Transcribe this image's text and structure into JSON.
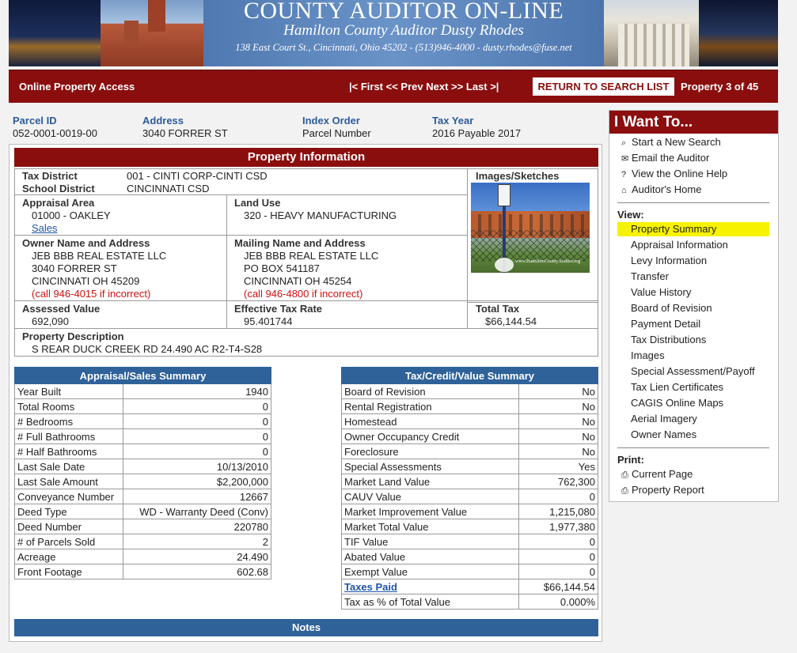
{
  "banner": {
    "title": "COUNTY AUDITOR ON-LINE",
    "subtitle": "Hamilton County Auditor Dusty Rhodes",
    "address": "138 East Court St., Cincinnati, Ohio 45202 - (513)946-4000 - dusty.rhodes@fuse.net"
  },
  "navbar": {
    "title": "Online Property Access",
    "first": "|< First",
    "prev": "<< Prev",
    "next": "Next >>",
    "last": "Last >|",
    "return": "RETURN TO SEARCH LIST",
    "position": "Property 3 of 45"
  },
  "header": {
    "parcel_label": "Parcel ID",
    "parcel_value": "052-0001-0019-00",
    "address_label": "Address",
    "address_value": "3040 FORRER ST",
    "index_label": "Index Order",
    "index_value": "Parcel Number",
    "taxyear_label": "Tax Year",
    "taxyear_value": "2016 Payable 2017"
  },
  "property_info": {
    "heading": "Property Information",
    "tax_district_label": "Tax District",
    "tax_district_value": "001 - CINTI CORP-CINTI CSD",
    "school_district_label": "School District",
    "school_district_value": "CINCINNATI CSD",
    "images_label": "Images/Sketches",
    "appraisal_area_label": "Appraisal Area",
    "appraisal_area_value": "01000 - OAKLEY",
    "sales_link": "Sales",
    "land_use_label": "Land Use",
    "land_use_value": "320 - HEAVY MANUFACTURING",
    "owner_label": "Owner Name and Address",
    "owner_line1": "JEB BBB REAL ESTATE LLC",
    "owner_line2": "3040 FORRER ST",
    "owner_line3": "CINCINNATI OH 45209",
    "owner_call": "(call 946-4015 if incorrect)",
    "mailing_label": "Mailing Name and Address",
    "mailing_line1": "JEB BBB REAL ESTATE LLC",
    "mailing_line2": "PO BOX 541187",
    "mailing_line3": "CINCINNATI OH 45254",
    "mailing_call": "(call 946-4800 if incorrect)",
    "assessed_label": "Assessed Value",
    "assessed_value": "692,090",
    "rate_label": "Effective Tax Rate",
    "rate_value": "95.401744",
    "total_tax_label": "Total Tax",
    "total_tax_value": "$66,144.54",
    "desc_label": "Property Description",
    "desc_value": "S REAR DUCK CREEK RD 24.490 AC R2-T4-S28",
    "photo_watermark": "www.HamiltonCountyAuditor.org"
  },
  "appraisal_summary": {
    "heading": "Appraisal/Sales Summary",
    "rows": [
      {
        "label": "Year Built",
        "value": "1940"
      },
      {
        "label": "Total Rooms",
        "value": "0"
      },
      {
        "label": "# Bedrooms",
        "value": "0"
      },
      {
        "label": "# Full Bathrooms",
        "value": "0"
      },
      {
        "label": "# Half Bathrooms",
        "value": "0"
      },
      {
        "label": "Last Sale Date",
        "value": "10/13/2010"
      },
      {
        "label": "Last Sale Amount",
        "value": "$2,200,000"
      },
      {
        "label": "Conveyance Number",
        "value": "12667"
      },
      {
        "label": "Deed Type",
        "value": "WD - Warranty Deed (Conv)"
      },
      {
        "label": "Deed Number",
        "value": "220780"
      },
      {
        "label": "# of Parcels Sold",
        "value": "2"
      },
      {
        "label": "Acreage",
        "value": "24.490"
      },
      {
        "label": "Front Footage",
        "value": "602.68"
      }
    ]
  },
  "tax_summary": {
    "heading": "Tax/Credit/Value Summary",
    "rows": [
      {
        "label": "Board of Revision",
        "value": "No"
      },
      {
        "label": "Rental Registration",
        "value": "No"
      },
      {
        "label": "Homestead",
        "value": "No"
      },
      {
        "label": "Owner Occupancy Credit",
        "value": "No"
      },
      {
        "label": "Foreclosure",
        "value": "No"
      },
      {
        "label": "Special Assessments",
        "value": "Yes"
      },
      {
        "label": "Market Land Value",
        "value": "762,300"
      },
      {
        "label": "CAUV Value",
        "value": "0"
      },
      {
        "label": "Market Improvement Value",
        "value": "1,215,080"
      },
      {
        "label": "Market Total Value",
        "value": "1,977,380"
      },
      {
        "label": "TIF Value",
        "value": "0"
      },
      {
        "label": "Abated Value",
        "value": "0"
      },
      {
        "label": "Exempt Value",
        "value": "0"
      },
      {
        "label": "Taxes Paid",
        "value": "$66,144.54"
      },
      {
        "label": "Tax as % of Total Value",
        "value": "0.000%"
      }
    ]
  },
  "notes": {
    "heading": "Notes"
  },
  "side": {
    "heading": "I Want To...",
    "actions": [
      {
        "icon": "⌕",
        "label": "Start a New Search"
      },
      {
        "icon": "✉",
        "label": "Email the Auditor"
      },
      {
        "icon": "?",
        "label": "View the Online Help"
      },
      {
        "icon": "⌂",
        "label": "Auditor's Home"
      }
    ],
    "view_label": "View:",
    "views": [
      "Property Summary",
      "Appraisal Information",
      "Levy Information",
      "Transfer",
      "Value History",
      "Board of Revision",
      "Payment Detail",
      "Tax Distributions",
      "Images",
      "Special Assessment/Payoff",
      "Tax Lien Certificates",
      "CAGIS Online Maps",
      "Aerial Imagery",
      "Owner Names"
    ],
    "print_label": "Print:",
    "prints": [
      "Current Page",
      "Property Report"
    ],
    "highlight_color": "#f7f200"
  },
  "colors": {
    "brand_red": "#8b0e0e",
    "table_blue": "#2f6299",
    "label_blue": "#2d5b9c"
  }
}
